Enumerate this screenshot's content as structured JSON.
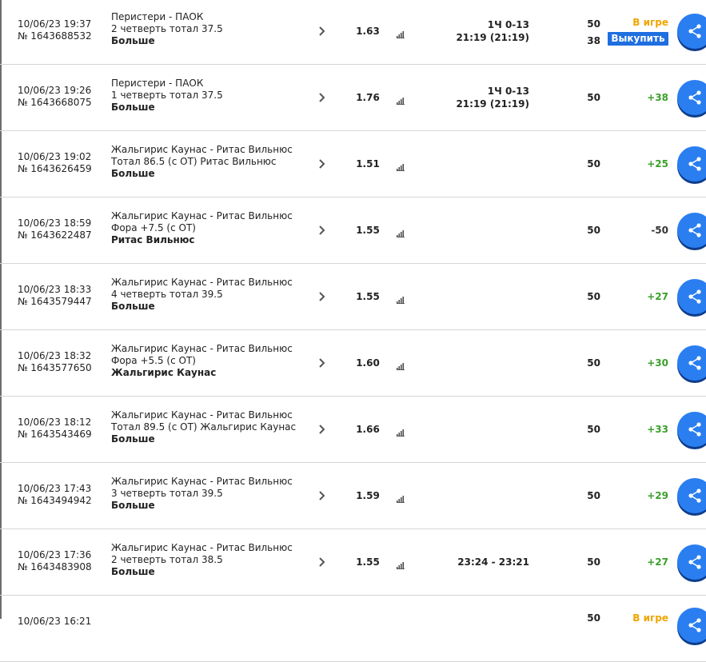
{
  "icons": {
    "row_toggle": "chevron-right-icon",
    "stats": "bar-chart-icon",
    "share": "share-icon"
  },
  "colors": {
    "win": "#3aa02a",
    "live": "#f0a500",
    "buyout_bg": "#1f6fe0",
    "share_bg": "#2a7ef0"
  },
  "bets": [
    {
      "date": "10/06/23 19:37",
      "number": "№ 1643688532",
      "event": "Перистери - ПАОК",
      "market": "2 четверть тотал 37.5",
      "pick": "Больше",
      "odds": "1.63",
      "score_line1": "1Ч 0-13",
      "score_line2": "21:19 (21:19)",
      "stake": "50",
      "stake2": "38",
      "status": "В игре",
      "buyout_label": "Выкупить"
    },
    {
      "date": "10/06/23 19:26",
      "number": "№ 1643668075",
      "event": "Перистери - ПАОК",
      "market": "1 четверть тотал 37.5",
      "pick": "Больше",
      "odds": "1.76",
      "score_line1": "1Ч 0-13",
      "score_line2": "21:19 (21:19)",
      "stake": "50",
      "result": "+38"
    },
    {
      "date": "10/06/23 19:02",
      "number": "№ 1643626459",
      "event": "Жальгирис Каунас - Ритас Вильнюс",
      "market": "Тотал 86.5 (с ОТ) Ритас Вильнюс",
      "pick": "Больше",
      "odds": "1.51",
      "stake": "50",
      "result": "+25"
    },
    {
      "date": "10/06/23 18:59",
      "number": "№ 1643622487",
      "event": "Жальгирис Каунас - Ритас Вильнюс",
      "market": "Фора +7.5 (с ОТ)",
      "pick": "Ритас Вильнюс",
      "odds": "1.55",
      "stake": "50",
      "result": "-50"
    },
    {
      "date": "10/06/23 18:33",
      "number": "№ 1643579447",
      "event": "Жальгирис Каунас - Ритас Вильнюс",
      "market": "4 четверть тотал 39.5",
      "pick": "Больше",
      "odds": "1.55",
      "stake": "50",
      "result": "+27"
    },
    {
      "date": "10/06/23 18:32",
      "number": "№ 1643577650",
      "event": "Жальгирис Каунас - Ритас Вильнюс",
      "market": "Фора +5.5 (с ОТ)",
      "pick": "Жальгирис Каунас",
      "odds": "1.60",
      "stake": "50",
      "result": "+30"
    },
    {
      "date": "10/06/23 18:12",
      "number": "№ 1643543469",
      "event": "Жальгирис Каунас - Ритас Вильнюс",
      "market": "Тотал 89.5 (с ОТ) Жальгирис Каунас",
      "pick": "Больше",
      "odds": "1.66",
      "stake": "50",
      "result": "+33"
    },
    {
      "date": "10/06/23 17:43",
      "number": "№ 1643494942",
      "event": "Жальгирис Каунас - Ритас Вильнюс",
      "market": "3 четверть тотал 39.5",
      "pick": "Больше",
      "odds": "1.59",
      "stake": "50",
      "result": "+29"
    },
    {
      "date": "10/06/23 17:36",
      "number": "№ 1643483908",
      "event": "Жальгирис Каунас - Ритас Вильнюс",
      "market": "2 четверть тотал 38.5",
      "pick": "Больше",
      "odds": "1.55",
      "score_line1": "23:24 - 23:21",
      "stake": "50",
      "result": "+27"
    },
    {
      "date": "10/06/23 16:21",
      "stake": "50",
      "status": "В игре"
    }
  ]
}
